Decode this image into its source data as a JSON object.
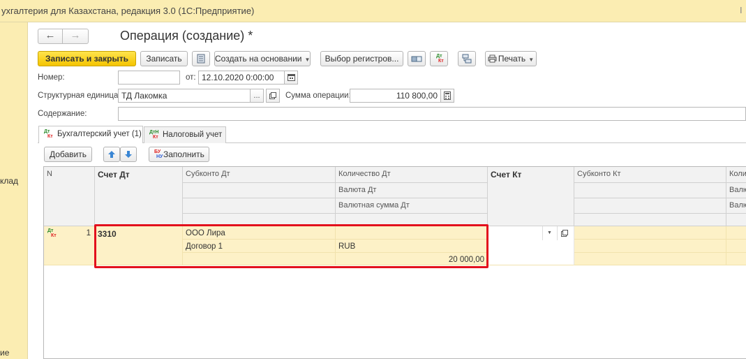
{
  "window": {
    "title": "ухгалтерия для Казахстана, редакция 3.0  (1С:Предприятие)",
    "close_glyph": "I"
  },
  "left_panel": {
    "items": [
      "клад",
      "ие"
    ]
  },
  "form": {
    "title": "Операция (создание) *",
    "nav": {
      "back": "←",
      "forward": "→"
    }
  },
  "toolbar": {
    "save_close": "Записать и закрыть",
    "save": "Записать",
    "create_based": "Создать на основании",
    "select_registers": "Выбор регистров...",
    "print": "Печать"
  },
  "fields": {
    "number_label": "Номер:",
    "number_value": "",
    "date_label": "от:",
    "date_value": "12.10.2020  0:00:00",
    "unit_label": "Структурная единица:",
    "unit_value": "ТД Лакомка",
    "sum_label": "Сумма операции:",
    "sum_value": "110 800,00",
    "content_label": "Содержание:",
    "content_value": ""
  },
  "tabs": [
    {
      "label": "Бухгалтерский учет (1)",
      "active": true
    },
    {
      "label": "Налоговый учет",
      "active": false
    }
  ],
  "table_toolbar": {
    "add": "Добавить",
    "fill": "Заполнить"
  },
  "dtkt": {
    "dt": "Дт",
    "kt": "Кт",
    "dtn": "ДтН",
    "bu": "БУ",
    "nu": "НУ"
  },
  "table": {
    "headers": {
      "n": "N",
      "schet_dt": "Счет Дт",
      "subkonto_dt": "Субконто Дт",
      "kol_dt": "Количество Дт",
      "val_dt": "Валюта Дт",
      "valsum_dt": "Валютная сумма Дт",
      "schet_kt": "Счет Кт",
      "subkonto_kt": "Субконто Кт",
      "kol_kt": "Коли",
      "val_kt": "Валю",
      "valsum_kt": "Валю"
    },
    "rows": [
      {
        "n": "1",
        "schet_dt": "3310",
        "subkonto_dt_1": "ООО Лира",
        "subkonto_dt_2": "Договор 1",
        "currency": "RUB",
        "amount": "20 000,00"
      }
    ]
  },
  "colors": {
    "title_bg": "#fbedb2",
    "primary_button": "#f4c400",
    "row_highlight": "#fdf1c7",
    "highlight_border": "#e3101d"
  }
}
